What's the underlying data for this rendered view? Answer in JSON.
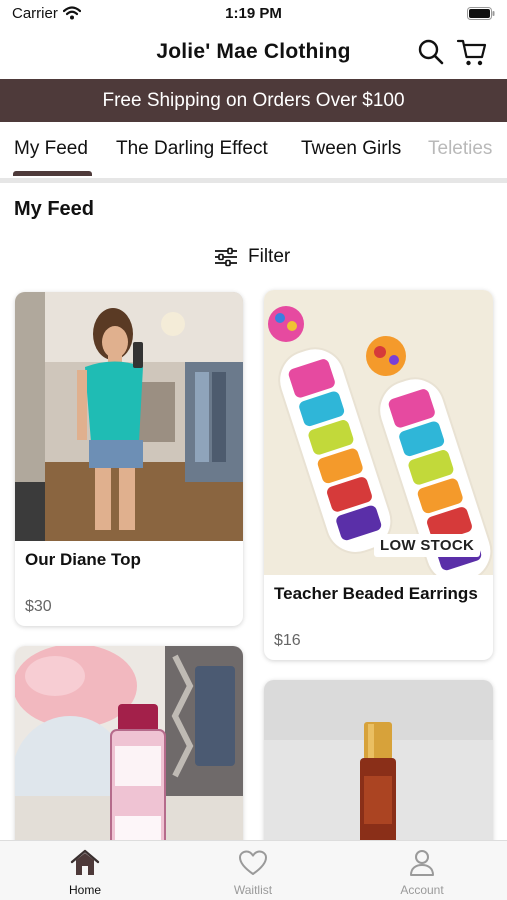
{
  "status_bar": {
    "carrier": "Carrier",
    "time": "1:19 PM"
  },
  "header": {
    "title": "Jolie' Mae Clothing"
  },
  "promo": {
    "text": "Free Shipping on Orders Over $100"
  },
  "tabs": [
    {
      "label": "My Feed",
      "active": true
    },
    {
      "label": "The Darling Effect",
      "active": false
    },
    {
      "label": "Tween Girls",
      "active": false
    },
    {
      "label": "Teleties",
      "active": false
    }
  ],
  "section": {
    "title": "My Feed"
  },
  "filter": {
    "label": "Filter"
  },
  "products": [
    {
      "name": "Our Diane Top",
      "price": "$30",
      "badge": ""
    },
    {
      "name": "Teacher Beaded Earrings",
      "price": "$16",
      "badge": "LOW STOCK"
    },
    {
      "name": "",
      "price": "",
      "badge": ""
    },
    {
      "name": "",
      "price": "",
      "badge": ""
    }
  ],
  "bottom_nav": [
    {
      "label": "Home",
      "icon": "home-icon",
      "active": true
    },
    {
      "label": "Waitlist",
      "icon": "heart-icon",
      "active": false
    },
    {
      "label": "Account",
      "icon": "person-icon",
      "active": false
    }
  ],
  "colors": {
    "brand": "#4e3a3a",
    "tab_inactive_faded": "#b9b9b9",
    "nav_inactive": "#9a9a9a"
  }
}
